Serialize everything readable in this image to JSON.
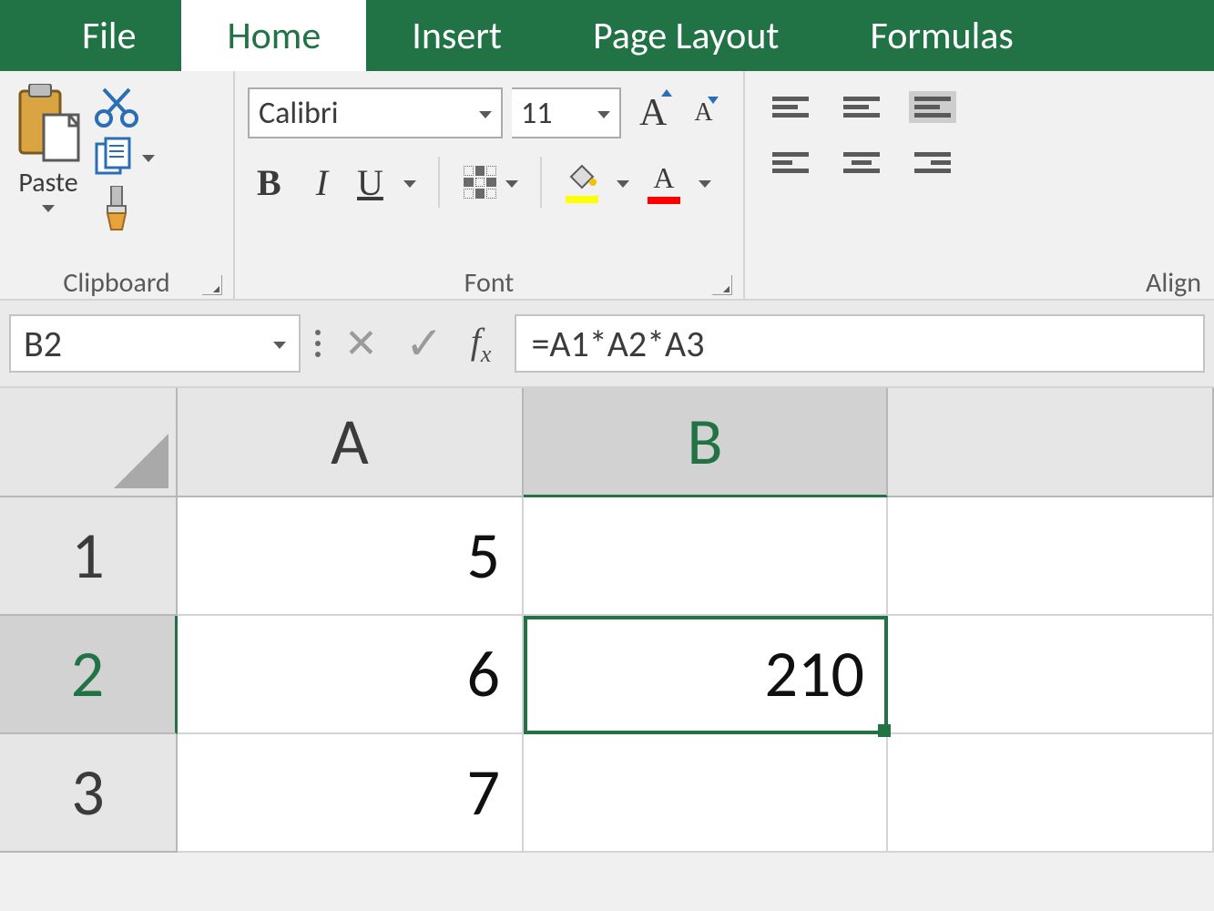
{
  "tabs": {
    "file": "File",
    "home": "Home",
    "insert": "Insert",
    "pageLayout": "Page Layout",
    "formulas": "Formulas"
  },
  "clipboard": {
    "paste": "Paste",
    "groupLabel": "Clipboard"
  },
  "font": {
    "name": "Calibri",
    "size": "11",
    "bold": "B",
    "italic": "I",
    "underline": "U",
    "bigA": "A",
    "smallA": "A",
    "colorA": "A",
    "groupLabel": "Font"
  },
  "align": {
    "groupLabel": "Align"
  },
  "formulaBar": {
    "nameBox": "B2",
    "formula": "=A1*A2*A3"
  },
  "grid": {
    "colA": "A",
    "colB": "B",
    "r1": "1",
    "r2": "2",
    "r3": "3",
    "A1": "5",
    "A2": "6",
    "A3": "7",
    "B1": "",
    "B2": "210",
    "B3": ""
  }
}
